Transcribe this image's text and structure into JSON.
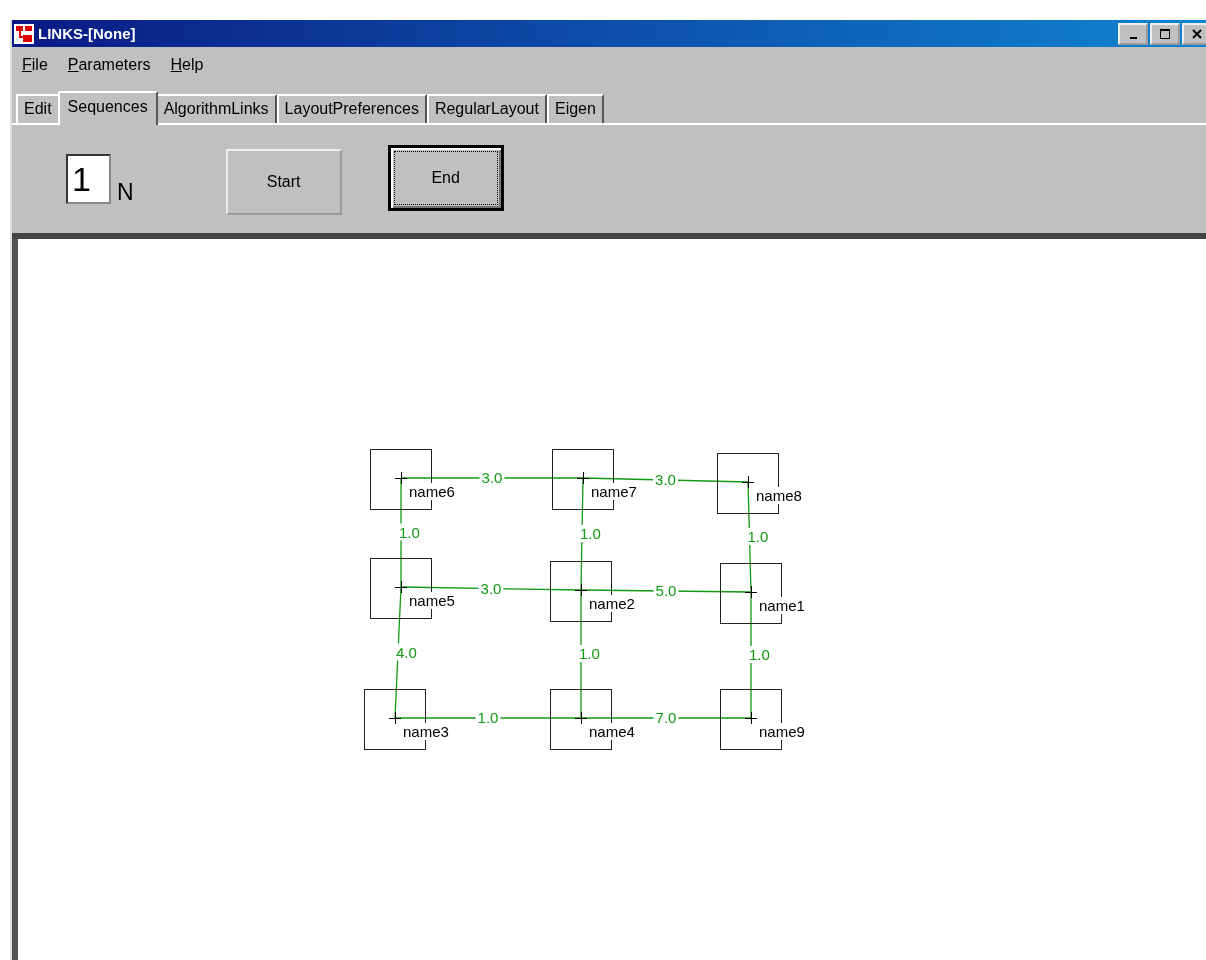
{
  "window": {
    "title": "LINKS-[None]"
  },
  "menu": [
    {
      "label": "File",
      "first_letter_underlined": true
    },
    {
      "label": "Parameters",
      "first_letter_underlined": true
    },
    {
      "label": "Help",
      "first_letter_underlined": true
    }
  ],
  "tabs": [
    {
      "label": "Edit",
      "selected": false
    },
    {
      "label": "Sequences",
      "selected": true
    },
    {
      "label": "AlgorithmLinks",
      "selected": false
    },
    {
      "label": "LayoutPreferences",
      "selected": false
    },
    {
      "label": "RegularLayout",
      "selected": false
    },
    {
      "label": "Eigen",
      "selected": false
    }
  ],
  "toolbar": {
    "count_field": {
      "value": "1",
      "unit": "N"
    },
    "buttons": [
      {
        "label": "Start",
        "focused": false
      },
      {
        "label": "End",
        "focused": true
      }
    ]
  },
  "graph": {
    "rows": [
      [
        {
          "label": "name6",
          "right_link": "3.0",
          "down_link": "1.0"
        },
        {
          "label": "name7",
          "right_link": "3.0",
          "down_link": "1.0"
        },
        {
          "label": "name8",
          "down_link": "1.0"
        }
      ],
      [
        {
          "label": "name5",
          "right_link": "3.0",
          "down_link": "4.0"
        },
        {
          "label": "name2",
          "right_link": "5.0",
          "down_link": "1.0"
        },
        {
          "label": "name1",
          "down_link": "1.0"
        }
      ],
      [
        {
          "label": "name3",
          "right_link": "1.0"
        },
        {
          "label": "name4",
          "right_link": "7.0"
        },
        {
          "label": "name9"
        }
      ]
    ]
  }
}
